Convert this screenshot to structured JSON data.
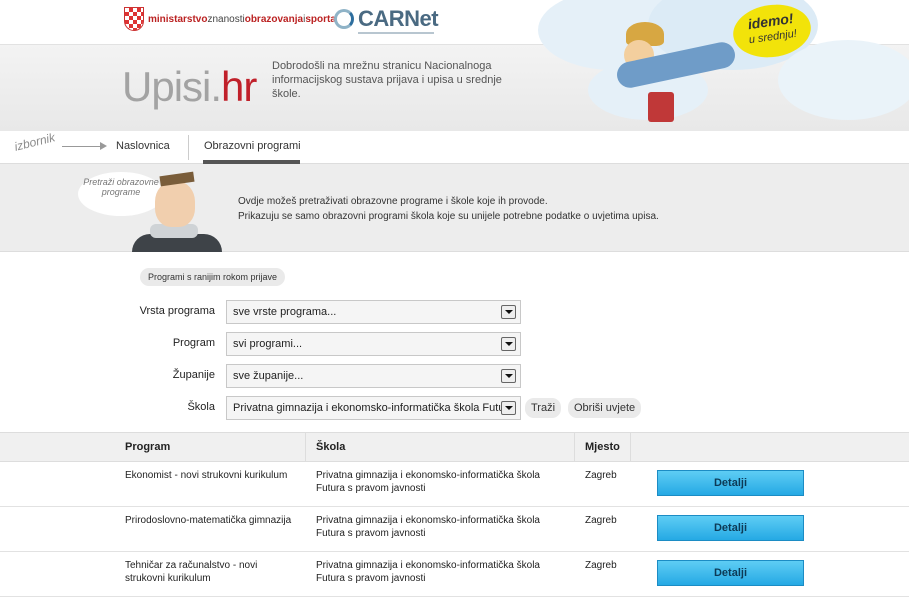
{
  "header": {
    "ministry": {
      "part1": "ministarstvo",
      "part2": "znanosti",
      "part3": "obrazovanja",
      "part4": "i",
      "part5": "sporta"
    },
    "carnet": "CARNet",
    "brand_part1": "Upisi.",
    "brand_part2": "hr",
    "welcome": "Dobrodošli na mrežnu stranicu Nacionalnoga informacijskog sustava prijava i upisa u srednje škole.",
    "badge_line1": "idemo!",
    "badge_line2": "u srednju!"
  },
  "nav": {
    "izbornik": "izbornik",
    "items": [
      {
        "label": "Naslovnica"
      },
      {
        "label": "Obrazovni programi"
      }
    ]
  },
  "intro": {
    "bubble": "Pretraži obrazovne programe",
    "line1": "Ovdje možeš pretraživati obrazovne programe i škole koje ih provode.",
    "line2": "Prikazuju se samo obrazovni programi škola koje su unijele potrebne podatke o uvjetima upisa."
  },
  "filters": {
    "early_label": "Programi s ranijim rokom prijave",
    "vrsta": {
      "label": "Vrsta programa",
      "value": "sve vrste programa..."
    },
    "program": {
      "label": "Program",
      "value": "svi programi..."
    },
    "zupanije": {
      "label": "Županije",
      "value": "sve županije..."
    },
    "skola": {
      "label": "Škola",
      "value": "Privatna gimnazija i ekonomsko-informatička škola Futura"
    },
    "search_label": "Traži",
    "clear_label": "Obriši uvjete"
  },
  "table": {
    "headers": {
      "program": "Program",
      "skola": "Škola",
      "mjesto": "Mjesto"
    },
    "details_label": "Detalji",
    "rows": [
      {
        "program": "Ekonomist - novi strukovni kurikulum",
        "skola": "Privatna gimnazija i ekonomsko-informatička škola Futura s pravom javnosti",
        "mjesto": "Zagreb"
      },
      {
        "program": "Prirodoslovno-matematička gimnazija",
        "skola": "Privatna gimnazija i ekonomsko-informatička škola Futura s pravom javnosti",
        "mjesto": "Zagreb"
      },
      {
        "program": "Tehničar za računalstvo - novi strukovni kurikulum",
        "skola": "Privatna gimnazija i ekonomsko-informatička škola Futura s pravom javnosti",
        "mjesto": "Zagreb"
      }
    ]
  },
  "colors": {
    "accent": "#c0202a",
    "button": "#25a9e4"
  }
}
